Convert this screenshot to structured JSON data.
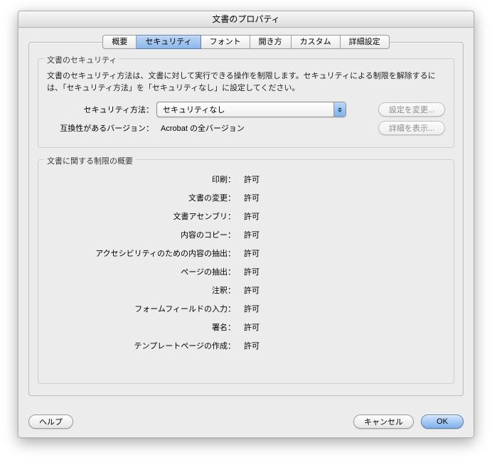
{
  "title": "文書のプロパティ",
  "tabs": {
    "t0": "概要",
    "t1": "セキュリティ",
    "t2": "フォント",
    "t3": "開き方",
    "t4": "カスタム",
    "t5": "詳細設定"
  },
  "group1": {
    "title": "文書のセキュリティ",
    "desc": "文書のセキュリティ方法は、文書に対して実行できる操作を制限します。セキュリティによる制限を解除するには、「セキュリティ方法」を「セキュリティなし」に設定してください。",
    "method_label": "セキュリティ方法：",
    "method_value": "セキュリティなし",
    "change_btn": "設定を変更...",
    "compat_label": "互換性があるバージョン：",
    "compat_value": "Acrobat の全バージョン",
    "details_btn": "詳細を表示..."
  },
  "group2": {
    "title": "文書に関する制限の概要",
    "rows": [
      {
        "label": "印刷：",
        "value": "許可"
      },
      {
        "label": "文書の変更：",
        "value": "許可"
      },
      {
        "label": "文書アセンブリ：",
        "value": "許可"
      },
      {
        "label": "内容のコピー：",
        "value": "許可"
      },
      {
        "label": "アクセシビリティのための内容の抽出：",
        "value": "許可"
      },
      {
        "label": "ページの抽出：",
        "value": "許可"
      },
      {
        "label": "注釈：",
        "value": "許可"
      },
      {
        "label": "フォームフィールドの入力：",
        "value": "許可"
      },
      {
        "label": "署名：",
        "value": "許可"
      },
      {
        "label": "テンプレートページの作成：",
        "value": "許可"
      }
    ]
  },
  "footer": {
    "help": "ヘルプ",
    "cancel": "キャンセル",
    "ok": "OK"
  }
}
